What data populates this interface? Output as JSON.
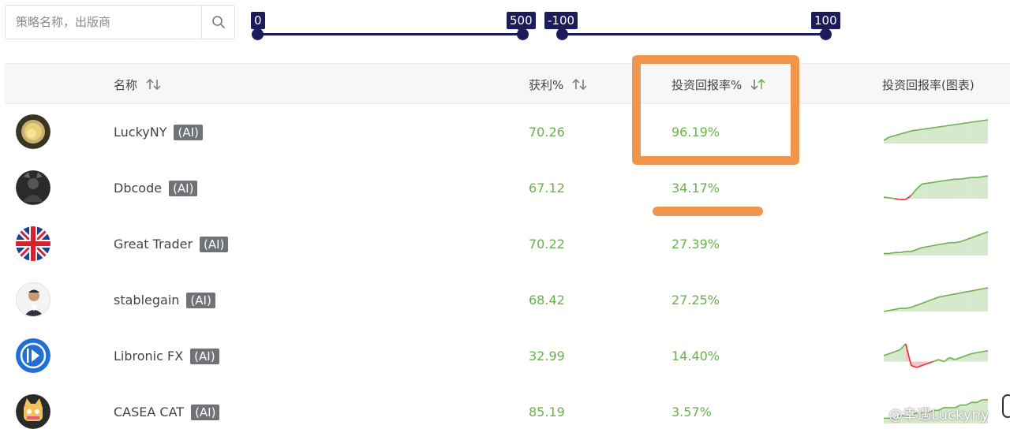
{
  "search": {
    "placeholder": "策略名称，出版商",
    "icon": "search-icon"
  },
  "filters": {
    "profit_range": {
      "min_label": "0",
      "max_label": "500",
      "min": 0,
      "max": 500
    },
    "roi_range": {
      "min_label": "-100",
      "max_label": "100",
      "min": -100,
      "max": 100
    }
  },
  "table": {
    "columns": {
      "name": "名称",
      "profit": "获利%",
      "roi": "投资回报率%",
      "roi_chart": "投资回报率(图表)"
    },
    "rows": [
      {
        "name": "LuckyNY",
        "ai": "(AI)",
        "profit": "70.26",
        "roi": "96.19%",
        "avatar": "gold-coin-avatar",
        "spark": [
          2,
          4,
          5,
          6,
          7,
          8,
          8.5,
          9,
          9.5,
          10,
          10.5,
          11,
          11.5,
          12,
          12.5,
          13,
          13.5,
          14,
          14.5,
          15
        ]
      },
      {
        "name": "Dbcode",
        "ai": "(AI)",
        "profit": "67.12",
        "roi": "34.17%",
        "avatar": "dark-person-avatar",
        "spark": [
          1,
          0.5,
          0,
          -0.5,
          -0.5,
          2,
          6,
          9,
          9.5,
          10,
          10.5,
          11,
          11.5,
          12,
          12,
          12.5,
          13,
          13,
          13.5,
          14
        ]
      },
      {
        "name": "Great Trader",
        "ai": "(AI)",
        "profit": "70.22",
        "roi": "27.39%",
        "avatar": "uk-flag-avatar",
        "spark": [
          1,
          1,
          1.5,
          1.5,
          2,
          2,
          3,
          4,
          4.5,
          5,
          5.5,
          6,
          6.5,
          6.5,
          7,
          8,
          9,
          10,
          11,
          12
        ]
      },
      {
        "name": "stablegain",
        "ai": "(AI)",
        "profit": "68.42",
        "roi": "27.25%",
        "avatar": "man-suit-avatar",
        "spark": [
          0,
          0.5,
          1,
          1.5,
          1.5,
          2,
          3,
          4,
          5,
          6,
          7,
          7.5,
          8,
          8.5,
          9,
          9.5,
          10,
          10.5,
          11,
          11.5
        ]
      },
      {
        "name": "Libronic FX",
        "ai": "(AI)",
        "profit": "32.99",
        "roi": "14.40%",
        "avatar": "libronic-logo-avatar",
        "spark": [
          3,
          4,
          5,
          6,
          9,
          -2,
          -3,
          -2,
          -1,
          0,
          1,
          0,
          2,
          1,
          2,
          3,
          4,
          4.5,
          5,
          5.5
        ]
      },
      {
        "name": "CASEA CAT",
        "ai": "(AI)",
        "profit": "85.19",
        "roi": "3.57%",
        "avatar": "cat-robot-avatar",
        "spark": [
          1,
          1,
          1,
          1.5,
          1.5,
          1.5,
          2,
          2,
          2,
          2.5,
          2.5,
          3,
          3,
          3,
          3.5,
          3.5,
          4,
          4,
          4.5,
          4.5
        ]
      }
    ]
  },
  "watermark": {
    "text": "@幸遇Luckyny"
  },
  "colors": {
    "accent": "#1c1c5a",
    "positive": "#6ab04c",
    "negative": "#e0303a",
    "highlight": "#f0954d"
  }
}
